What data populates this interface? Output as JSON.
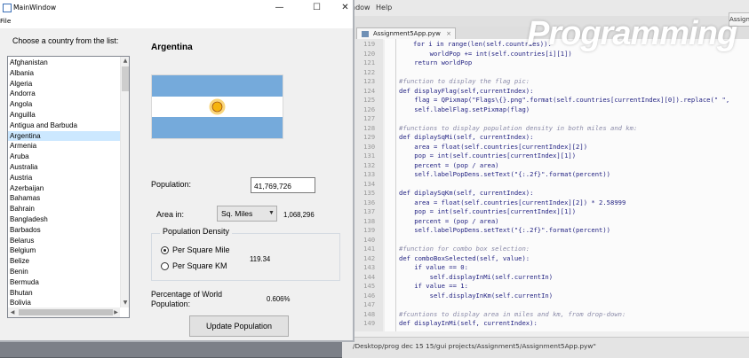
{
  "background_editor": {
    "menu_items": [
      "ndow",
      "Help"
    ],
    "tab_label": "Assignment5App.pyw",
    "corner_tab": "Assignm",
    "banner_title": "Programming",
    "status_text": "/Desktop/prog dec 15 15/gui projects/Assignment5/Assignment5App.pyw\"",
    "line_numbers": [
      "119",
      "120",
      "121",
      "122",
      "123",
      "124",
      "125",
      "126",
      "127",
      "128",
      "129",
      "130",
      "131",
      "132",
      "133",
      "134",
      "135",
      "136",
      "137",
      "138",
      "139",
      "140",
      "141",
      "142",
      "143",
      "144",
      "145",
      "146",
      "147",
      "148",
      "149"
    ],
    "code_lines": [
      "for i in range(len(self.countries)):",
      "        worldPop += int(self.countries[i][1])",
      "    return worldPop",
      "",
      "#function to display the flag pic:",
      "def displayFlag(self,currentIndex):",
      "    flag = QPixmap(\"Flags\\{}.png\".format(self.countries[currentIndex][0]).replace(\" \",",
      "    self.labelFlag.setPixmap(flag)",
      "",
      "#functions to display population density in both miles and km:",
      "def diplaySqMi(self, currentIndex):",
      "    area = float(self.countries[currentIndex][2])",
      "    pop = int(self.countries[currentIndex][1])",
      "    percent = (pop / area)",
      "    self.labelPopDens.setText(\"{:.2f}\".format(percent))",
      "",
      "def diplaySqKm(self, currentIndex):",
      "    area = float(self.countries[currentIndex][2]) * 2.58999",
      "    pop = int(self.countries[currentIndex][1])",
      "    percent = (pop / area)",
      "    self.labelPopDens.setText(\"{:.2f}\".format(percent))",
      "",
      "#function for combo box selection:",
      "def comboBoxSelected(self, value):",
      "    if value == 0:",
      "        self.displayInMi(self.currentIn)",
      "    if value == 1:",
      "        self.displayInKm(self.currentIn)",
      "",
      "#fcuntions to display area in miles and km, from drop-down:",
      "def displayInMi(self, currentIndex):"
    ]
  },
  "window": {
    "title": "MainWindow",
    "menu_file": "File",
    "minimize": "—",
    "maximize": "☐",
    "close": "✕"
  },
  "left_panel": {
    "prompt": "Choose a country from the list:",
    "countries": [
      "Afghanistan",
      "Albania",
      "Algeria",
      "Andorra",
      "Angola",
      "Anguilla",
      "Antigua and Barbuda",
      "Argentina",
      "Armenia",
      "Aruba",
      "Australia",
      "Austria",
      "Azerbaijan",
      "Bahamas",
      "Bahrain",
      "Bangladesh",
      "Barbados",
      "Belarus",
      "Belgium",
      "Belize",
      "Benin",
      "Bermuda",
      "Bhutan",
      "Bolivia"
    ],
    "selected": "Argentina",
    "scroll_icons": {
      "up": "▲",
      "down": "▼",
      "left": "◀",
      "right": "▶"
    }
  },
  "details": {
    "country": "Argentina",
    "population_label": "Population:",
    "population_value": "41,769,726",
    "area_label": "Area in:",
    "area_unit": "Sq. Miles",
    "combo_arrow": "▼",
    "area_value": "1,068,296",
    "density_group_title": "Population Density",
    "radio_mile": "Per Square Mile",
    "radio_km": "Per Square KM",
    "selected_radio": "Per Square Mile",
    "density_value": "119.34",
    "percentage_label": "Percentage of World Population:",
    "percentage_value": "0.606%",
    "update_button": "Update Population"
  },
  "colors": {
    "selection": "#cce8ff",
    "flag_blue": "#75aadb",
    "flag_white": "#ffffff",
    "sun": "#f6b40e"
  }
}
